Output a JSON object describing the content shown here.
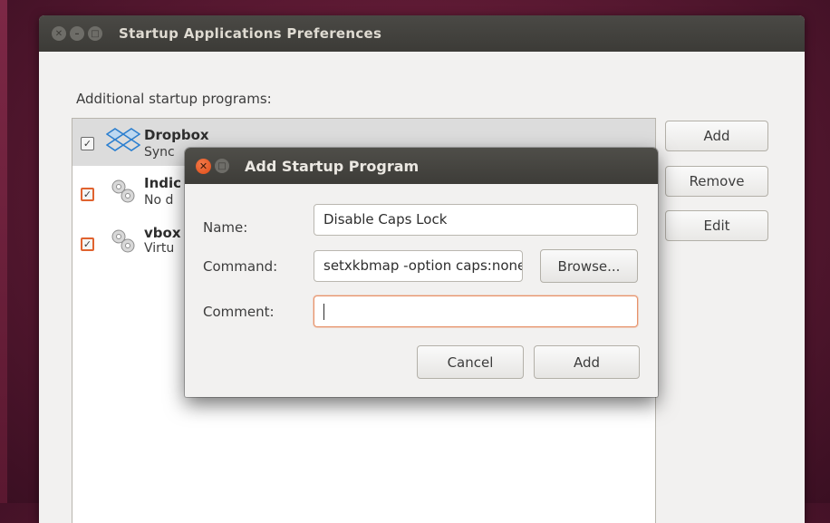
{
  "main_window": {
    "title": "Startup Applications Preferences",
    "section_label": "Additional startup programs:",
    "programs": [
      {
        "checked": true,
        "name": "Dropbox",
        "description": "Sync",
        "icon": "dropbox-icon"
      },
      {
        "checked": true,
        "name": "Indic",
        "description": "No d",
        "icon": "gears-icon"
      },
      {
        "checked": true,
        "name": "vbox",
        "description": "Virtu",
        "icon": "gears-icon"
      }
    ],
    "buttons": {
      "add": "Add",
      "remove": "Remove",
      "edit": "Edit"
    }
  },
  "dialog": {
    "title": "Add Startup Program",
    "name_label": "Name:",
    "name_value": "Disable Caps Lock",
    "command_label": "Command:",
    "command_value": "setxkbmap -option caps:none",
    "browse_label": "Browse...",
    "comment_label": "Comment:",
    "comment_value": "",
    "cancel_label": "Cancel",
    "add_label": "Add"
  },
  "colors": {
    "titlebar": "#3c3b37",
    "accent_orange": "#df4b16",
    "selection": "#dcdcdc",
    "desktop": "#5e1a34"
  }
}
